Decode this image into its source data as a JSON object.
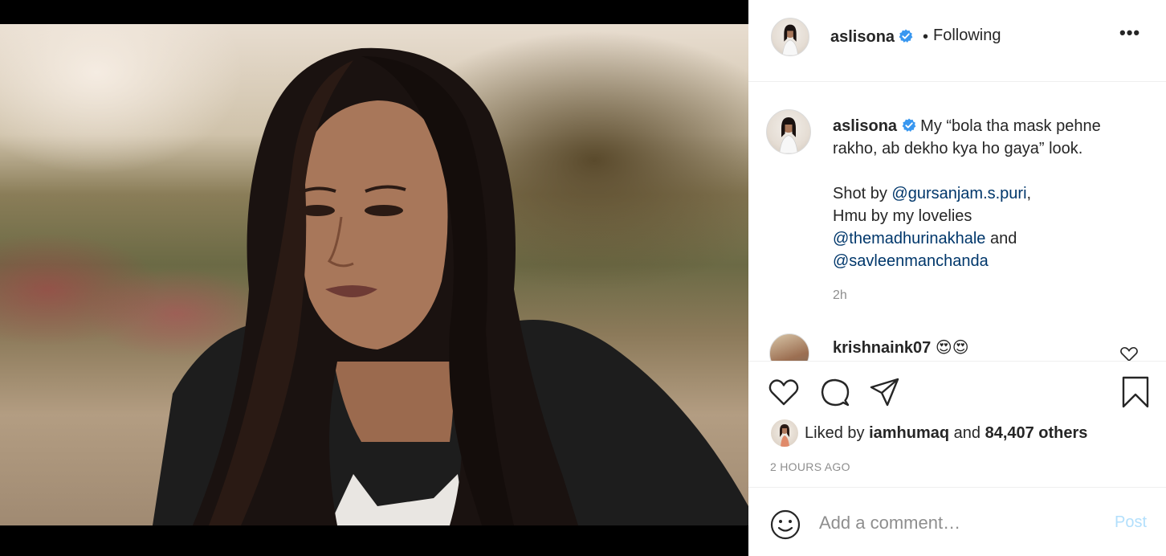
{
  "post": {
    "username": "aslisona",
    "follow_separator": "•",
    "follow_status": "Following",
    "more_label": "•••",
    "caption_line1": "My “bola tha mask pehne rakho, ab dekho kya ho gaya” look.",
    "shot_by_prefix": "Shot by ",
    "shot_by_mention": "@gursanjam.s.puri",
    "shot_by_suffix": ",",
    "hmu_text": "Hmu by my lovelies",
    "mention_2": "@themadhurinakhale",
    "and_text": " and",
    "mention_3": "@savleenmanchanda",
    "relative_time": "2h"
  },
  "comments": [
    {
      "username": "krishnaink07",
      "text": "😍😍"
    }
  ],
  "likes": {
    "prefix": "Liked by ",
    "liker": "iamhumaq",
    "middle": " and ",
    "others": "84,407 others"
  },
  "timestamp": "2 HOURS AGO",
  "compose": {
    "placeholder": "Add a comment…",
    "post_label": "Post"
  },
  "colors": {
    "verified": "#3897f0",
    "mention": "#00376b",
    "post_disabled": "#b2dffc",
    "muted": "#8e8e8e"
  },
  "icons": [
    "verified-badge-icon",
    "more-options-icon",
    "heart-icon",
    "comment-icon",
    "share-icon",
    "bookmark-icon",
    "emoji-icon",
    "heart-small-icon"
  ]
}
